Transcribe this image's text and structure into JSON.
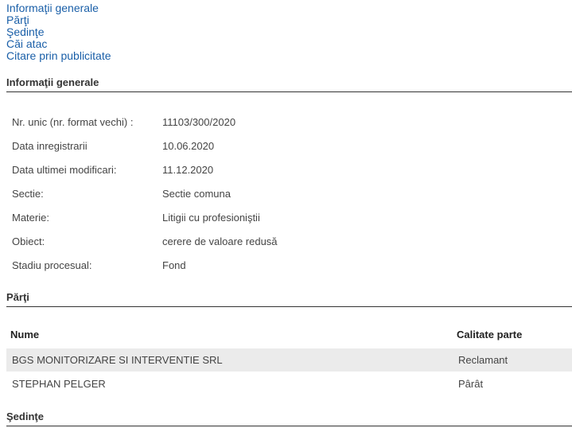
{
  "nav": [
    {
      "label": "Informaţii generale"
    },
    {
      "label": "Părţi"
    },
    {
      "label": "Şedinţe"
    },
    {
      "label": "Căi atac"
    },
    {
      "label": "Citare prin publicitate"
    }
  ],
  "sections": {
    "info": "Informaţii generale",
    "parti": "Părţi",
    "sedinte": "Şedinţe"
  },
  "info": [
    {
      "label": "Nr. unic (nr. format vechi) :",
      "value": "11103/300/2020"
    },
    {
      "label": "Data inregistrarii",
      "value": "10.06.2020"
    },
    {
      "label": "Data ultimei modificari:",
      "value": "11.12.2020"
    },
    {
      "label": "Sectie:",
      "value": "Sectie comuna"
    },
    {
      "label": "Materie:",
      "value": "Litigii cu profesioniştii"
    },
    {
      "label": "Obiect:",
      "value": "cerere de valoare redusă"
    },
    {
      "label": "Stadiu procesual:",
      "value": "Fond"
    }
  ],
  "parti": {
    "columns": [
      "Nume",
      "Calitate parte"
    ],
    "rows": [
      {
        "name": "BGS MONITORIZARE SI INTERVENTIE SRL",
        "calitate": "Reclamant"
      },
      {
        "name": "STEPHAN PELGER",
        "calitate": "Pârât"
      }
    ]
  }
}
